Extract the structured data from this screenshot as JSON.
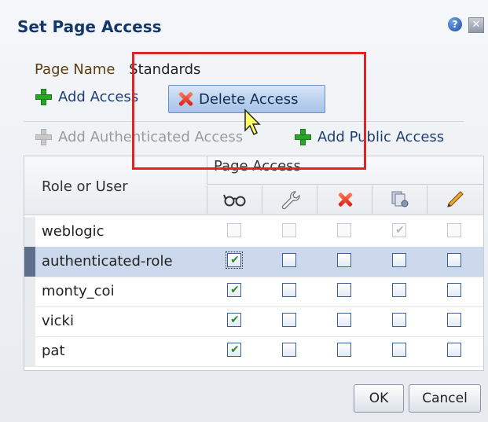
{
  "dialog": {
    "title": "Set Page Access",
    "help_icon": "help-icon",
    "close_icon": "close-icon"
  },
  "page": {
    "name_label": "Page Name",
    "name_value": "Standards"
  },
  "actions": {
    "add_access": "Add Access",
    "delete_access": "Delete Access",
    "add_authenticated_access": "Add Authenticated Access",
    "add_public_access": "Add Public Access"
  },
  "table": {
    "role_header": "Role or User",
    "page_access_header": "Page Access",
    "permission_icons": [
      "view-icon",
      "customize-icon",
      "delete-icon",
      "personalize-icon",
      "edit-icon"
    ],
    "rows": [
      {
        "label": "weblogic",
        "checks": [
          false,
          false,
          false,
          true,
          false
        ],
        "disabled": true,
        "selected": false
      },
      {
        "label": "authenticated-role",
        "checks": [
          true,
          false,
          false,
          false,
          false
        ],
        "disabled": false,
        "selected": true
      },
      {
        "label": "monty_coi",
        "checks": [
          true,
          false,
          false,
          false,
          false
        ],
        "disabled": false,
        "selected": false
      },
      {
        "label": "vicki",
        "checks": [
          true,
          false,
          false,
          false,
          false
        ],
        "disabled": false,
        "selected": false
      },
      {
        "label": "pat",
        "checks": [
          true,
          false,
          false,
          false,
          false
        ],
        "disabled": false,
        "selected": false
      }
    ]
  },
  "footer": {
    "ok_label": "OK",
    "cancel_label": "Cancel"
  }
}
